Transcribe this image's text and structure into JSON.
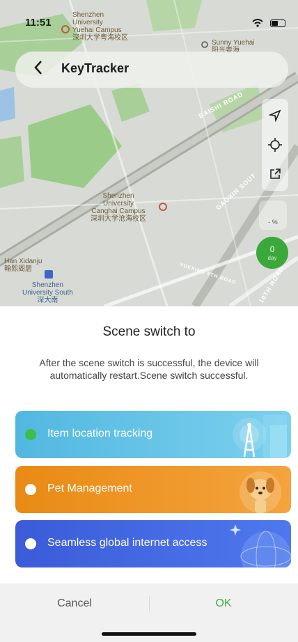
{
  "status_bar": {
    "time": "11:51"
  },
  "header": {
    "back_icon": "chevron-left-icon",
    "title": "KeyTracker"
  },
  "map": {
    "labels": {
      "campus_top_en": "Shenzhen\nUniversity\nYuehai Campus",
      "campus_top_cn": "深圳大学粤海校区",
      "sunny_en": "Sunny Yuehai",
      "sunny_cn": "阳光粤海",
      "canghai_en": "Shenzhen\nUniversity\nCanghai Campus",
      "canghai_cn": "深圳大学沧海校区",
      "han_en": "Han Xidanju",
      "han_cn": "翰熙阁居",
      "south_en": "Shenzhen\nUniversity South",
      "south_cn": "深大南"
    },
    "roads": {
      "baishi": "BAISHI ROAD",
      "gaoxin": "GAOXIN SOUT",
      "yuexing": "YUEXING 6TH ROAD",
      "tenth": "10TH ROAD"
    },
    "tools": [
      "navigate-icon",
      "locate-icon",
      "share-icon"
    ],
    "mini_badge": "- %",
    "green_badge": {
      "value": "0",
      "sub": "day"
    }
  },
  "panel": {
    "title": "Scene switch to",
    "description": "After the scene switch is successful, the device will automatically restart.Scene switch successful.",
    "options": [
      {
        "label": "Item location tracking",
        "selected": true,
        "color": "#52b8e0"
      },
      {
        "label": "Pet Management",
        "selected": false,
        "color": "#e98a14"
      },
      {
        "label": "Seamless global internet access",
        "selected": false,
        "color": "#3b5bd8"
      }
    ]
  },
  "footer": {
    "cancel": "Cancel",
    "ok": "OK"
  },
  "colors": {
    "accent_green": "#3cae3a"
  }
}
